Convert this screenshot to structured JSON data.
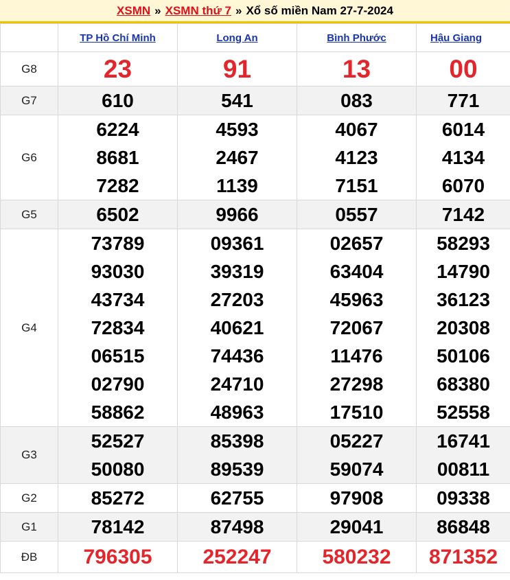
{
  "header": {
    "link1": "XSMN",
    "sep1": "»",
    "link2": "XSMN thứ 7",
    "sep2": "»",
    "title": "Xổ số miền Nam 27-7-2024"
  },
  "provinces": [
    "TP Hồ Chí Minh",
    "Long An",
    "Bình Phước",
    "Hậu Giang"
  ],
  "prizes": [
    {
      "label": "G8",
      "numbers": [
        [
          "23"
        ],
        [
          "91"
        ],
        [
          "13"
        ],
        [
          "00"
        ]
      ]
    },
    {
      "label": "G7",
      "numbers": [
        [
          "610"
        ],
        [
          "541"
        ],
        [
          "083"
        ],
        [
          "771"
        ]
      ]
    },
    {
      "label": "G6",
      "numbers": [
        [
          "6224",
          "8681",
          "7282"
        ],
        [
          "4593",
          "2467",
          "1139"
        ],
        [
          "4067",
          "4123",
          "7151"
        ],
        [
          "6014",
          "4134",
          "6070"
        ]
      ]
    },
    {
      "label": "G5",
      "numbers": [
        [
          "6502"
        ],
        [
          "9966"
        ],
        [
          "0557"
        ],
        [
          "7142"
        ]
      ]
    },
    {
      "label": "G4",
      "numbers": [
        [
          "73789",
          "93030",
          "43734",
          "72834",
          "06515",
          "02790",
          "58862"
        ],
        [
          "09361",
          "39319",
          "27203",
          "40621",
          "74436",
          "24710",
          "48963"
        ],
        [
          "02657",
          "63404",
          "45963",
          "72067",
          "11476",
          "27298",
          "17510"
        ],
        [
          "58293",
          "14790",
          "36123",
          "20308",
          "50106",
          "68380",
          "52558"
        ]
      ]
    },
    {
      "label": "G3",
      "numbers": [
        [
          "52527",
          "50080"
        ],
        [
          "85398",
          "89539"
        ],
        [
          "05227",
          "59074"
        ],
        [
          "16741",
          "00811"
        ]
      ]
    },
    {
      "label": "G2",
      "numbers": [
        [
          "85272"
        ],
        [
          "62755"
        ],
        [
          "97908"
        ],
        [
          "09338"
        ]
      ]
    },
    {
      "label": "G1",
      "numbers": [
        [
          "78142"
        ],
        [
          "87498"
        ],
        [
          "29041"
        ],
        [
          "86848"
        ]
      ]
    },
    {
      "label": "ĐB",
      "numbers": [
        [
          "796305"
        ],
        [
          "252247"
        ],
        [
          "580232"
        ],
        [
          "871352"
        ]
      ]
    }
  ]
}
